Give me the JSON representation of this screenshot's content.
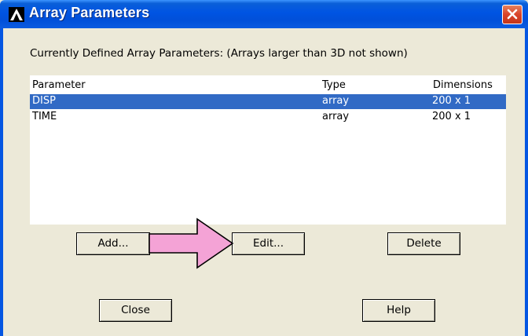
{
  "window": {
    "title": "Array Parameters",
    "icon": "ansys-logo-icon",
    "close_icon": "close-icon"
  },
  "header": {
    "label": "Currently Defined Array Parameters: (Arrays larger than 3D not shown)"
  },
  "table": {
    "columns": [
      "Parameter",
      "Type",
      "Dimensions"
    ],
    "rows": [
      {
        "parameter": "DISP",
        "type": "array",
        "dimensions": "200 x 1",
        "selected": true
      },
      {
        "parameter": "TIME",
        "type": "array",
        "dimensions": "200 x 1",
        "selected": false
      }
    ]
  },
  "buttons": {
    "add": "Add...",
    "edit": "Edit...",
    "delete": "Delete",
    "close": "Close",
    "help": "Help"
  },
  "annotation": {
    "icon": "pink-arrow-icon",
    "color": "#F4A3D6"
  },
  "colors": {
    "titlebar": "#0054E3",
    "selection": "#316AC5",
    "dialog_bg": "#ECE9D8"
  }
}
